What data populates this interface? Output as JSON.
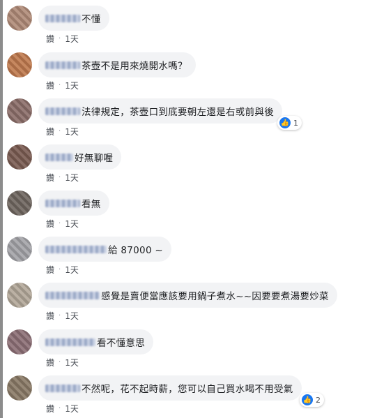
{
  "comments": [
    {
      "text": "不懂",
      "read": "讚",
      "dot": "·",
      "time": "1天",
      "avatar": "#b08b78",
      "name_w": 50
    },
    {
      "text": "茶壺不是用來燒開水嗎？",
      "read": "讚",
      "dot": "·",
      "time": "1天",
      "avatar": "#c07a4e",
      "name_w": 50
    },
    {
      "text": "法律規定，茶壺口到底要朝左還是右或前與後",
      "read": "讚",
      "dot": "·",
      "time": "1天",
      "avatar": "#8c6e6a",
      "name_w": 50,
      "likes": "1"
    },
    {
      "text": "好無聊喔",
      "read": "讚",
      "dot": "·",
      "time": "1天",
      "avatar": "#7b5c52",
      "name_w": 40
    },
    {
      "text": "看無",
      "read": "讚",
      "dot": "·",
      "time": "1天",
      "avatar": "#6f6660",
      "name_w": 50
    },
    {
      "text": "給 87000 ~",
      "read": "讚",
      "dot": "·",
      "time": "1天",
      "avatar": "#a4a4a8",
      "name_w": 88
    },
    {
      "text": "感覺是賣便當應該要用鍋子煮水~~因要要煮湯要炒菜",
      "read": "讚",
      "dot": "·",
      "time": "1天",
      "avatar": "#b3a89a",
      "name_w": 78
    },
    {
      "text": "看不懂意思",
      "read": "讚",
      "dot": "·",
      "time": "1天",
      "avatar": "#8d7076",
      "name_w": 72
    },
    {
      "text": "不然呢，花不起時薪，您可以自己買水喝不用受氣",
      "read": "讚",
      "dot": "·",
      "time": "1天",
      "avatar": "#8a7a66",
      "name_w": 50,
      "likes": "2"
    }
  ]
}
